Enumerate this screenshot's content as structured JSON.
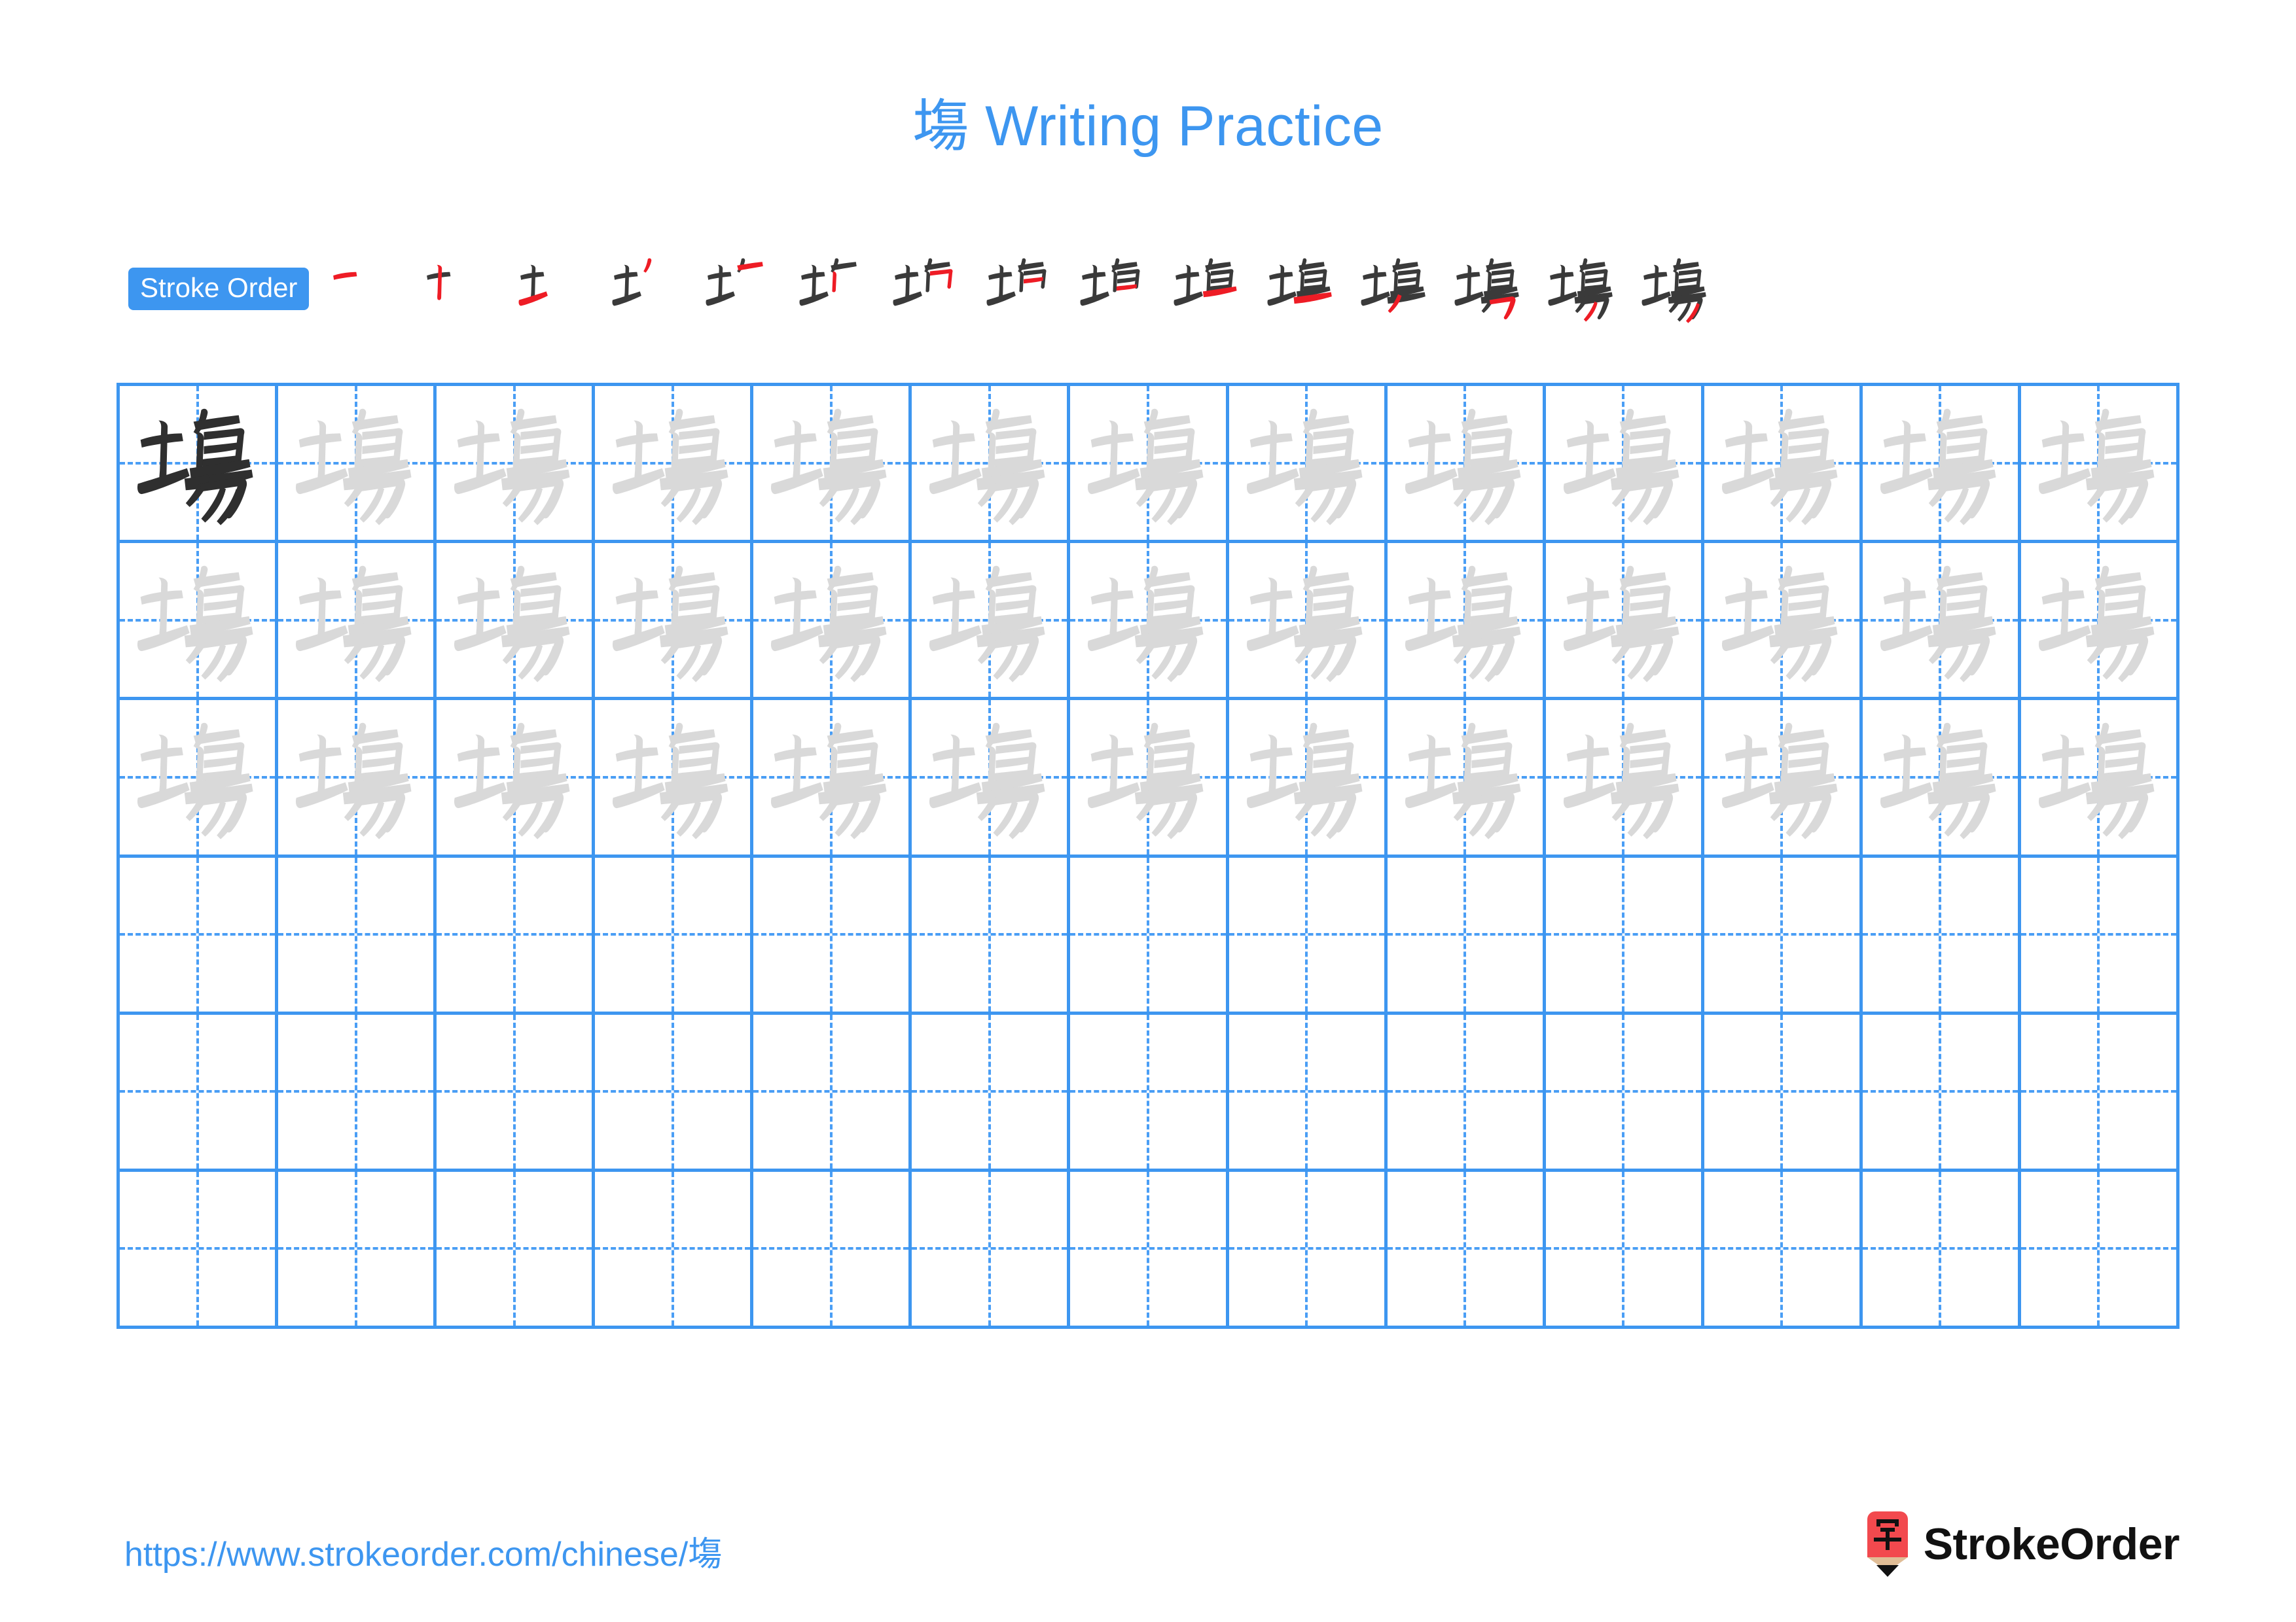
{
  "page": {
    "character": "塲",
    "title": "塲 Writing Practice",
    "background_color": "#ffffff",
    "accent_color": "#3d96f0",
    "stroke_done_color": "#3a3a3a",
    "stroke_new_color": "#ee1c25",
    "trace_glyph_color": "#d9d9d9",
    "model_glyph_color": "#2f2f2f"
  },
  "stroke_order": {
    "badge_label": "Stroke Order",
    "total_strokes": 15,
    "steps": [
      {
        "index": 1,
        "new_stroke": "heng"
      },
      {
        "index": 2,
        "new_stroke": "shu"
      },
      {
        "index": 3,
        "new_stroke": "heng"
      },
      {
        "index": 4,
        "new_stroke": "pie"
      },
      {
        "index": 5,
        "new_stroke": "heng"
      },
      {
        "index": 6,
        "new_stroke": "shu"
      },
      {
        "index": 7,
        "new_stroke": "hengzhe"
      },
      {
        "index": 8,
        "new_stroke": "heng"
      },
      {
        "index": 9,
        "new_stroke": "heng"
      },
      {
        "index": 10,
        "new_stroke": "heng"
      },
      {
        "index": 11,
        "new_stroke": "heng"
      },
      {
        "index": 12,
        "new_stroke": "pie"
      },
      {
        "index": 13,
        "new_stroke": "henggou"
      },
      {
        "index": 14,
        "new_stroke": "pie"
      },
      {
        "index": 15,
        "new_stroke": "pie"
      }
    ]
  },
  "practice_grid": {
    "columns": 13,
    "rows": 6,
    "rows_data": [
      {
        "row": 1,
        "cells": [
          "model",
          "trace",
          "trace",
          "trace",
          "trace",
          "trace",
          "trace",
          "trace",
          "trace",
          "trace",
          "trace",
          "trace",
          "trace"
        ]
      },
      {
        "row": 2,
        "cells": [
          "trace",
          "trace",
          "trace",
          "trace",
          "trace",
          "trace",
          "trace",
          "trace",
          "trace",
          "trace",
          "trace",
          "trace",
          "trace"
        ]
      },
      {
        "row": 3,
        "cells": [
          "trace",
          "trace",
          "trace",
          "trace",
          "trace",
          "trace",
          "trace",
          "trace",
          "trace",
          "trace",
          "trace",
          "trace",
          "trace"
        ]
      },
      {
        "row": 4,
        "cells": [
          "empty",
          "empty",
          "empty",
          "empty",
          "empty",
          "empty",
          "empty",
          "empty",
          "empty",
          "empty",
          "empty",
          "empty",
          "empty"
        ]
      },
      {
        "row": 5,
        "cells": [
          "empty",
          "empty",
          "empty",
          "empty",
          "empty",
          "empty",
          "empty",
          "empty",
          "empty",
          "empty",
          "empty",
          "empty",
          "empty"
        ]
      },
      {
        "row": 6,
        "cells": [
          "empty",
          "empty",
          "empty",
          "empty",
          "empty",
          "empty",
          "empty",
          "empty",
          "empty",
          "empty",
          "empty",
          "empty",
          "empty"
        ]
      }
    ]
  },
  "footer": {
    "url": "https://www.strokeorder.com/chinese/塲",
    "logo_character": "字",
    "logo_wordmark": "StrokeOrder",
    "logo_body_color": "#f2494e",
    "logo_tip_color": "#e0bd96"
  }
}
